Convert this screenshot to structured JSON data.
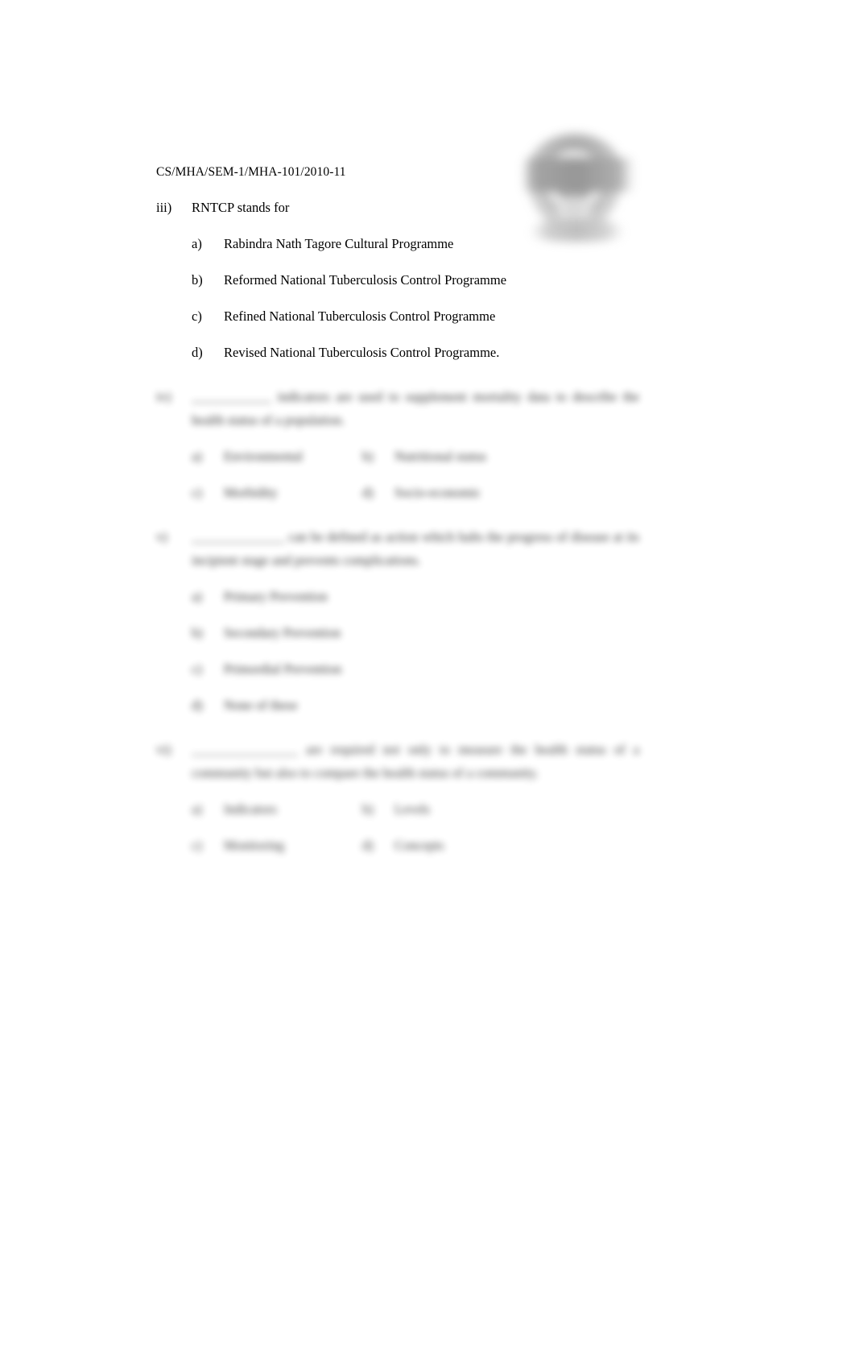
{
  "document": {
    "exam_code": "CS/MHA/SEM-1/MHA-101/2010-11",
    "logo_alt": "university-seal-watermark"
  },
  "questions": [
    {
      "id": "iii",
      "marker": "iii)",
      "stem": "RNTCP stands for",
      "legible": true,
      "layout": "single-column",
      "options": [
        {
          "marker": "a)",
          "text": "Rabindra Nath Tagore Cultural Programme",
          "justify": false
        },
        {
          "marker": "b)",
          "text": "Reformed National Tuberculosis Control Programme",
          "justify": true
        },
        {
          "marker": "c)",
          "text": "Refined National Tuberculosis Control Programme",
          "justify": false
        },
        {
          "marker": "d)",
          "text": "Revised National Tuberculosis Control Programme.",
          "justify": false
        }
      ]
    },
    {
      "id": "iv",
      "marker": "iv)",
      "stem": "____________ indicators are used to supplement mortality data to describe the health status of a population.",
      "legible": false,
      "layout": "two-column",
      "options": [
        {
          "marker": "a)",
          "text": "Environmental"
        },
        {
          "marker": "b)",
          "text": "Nutritional status"
        },
        {
          "marker": "c)",
          "text": "Morbidity"
        },
        {
          "marker": "d)",
          "text": "Socio-economic"
        }
      ]
    },
    {
      "id": "v",
      "marker": "v)",
      "stem": "______________ can be defined as action which halts the progress of disease at its incipient stage and prevents complications.",
      "legible": false,
      "layout": "single-column",
      "options": [
        {
          "marker": "a)",
          "text": "Primary Prevention"
        },
        {
          "marker": "b)",
          "text": "Secondary Prevention"
        },
        {
          "marker": "c)",
          "text": "Primordial Prevention"
        },
        {
          "marker": "d)",
          "text": "None of these"
        }
      ]
    },
    {
      "id": "vi",
      "marker": "vi)",
      "stem": "________________ are required not only to measure the health status of a community but also to compare the health status of a community.",
      "legible": false,
      "layout": "two-column",
      "options": [
        {
          "marker": "a)",
          "text": "Indicators"
        },
        {
          "marker": "b)",
          "text": "Levels"
        },
        {
          "marker": "c)",
          "text": "Monitoring"
        },
        {
          "marker": "d)",
          "text": "Concepts"
        }
      ]
    }
  ]
}
